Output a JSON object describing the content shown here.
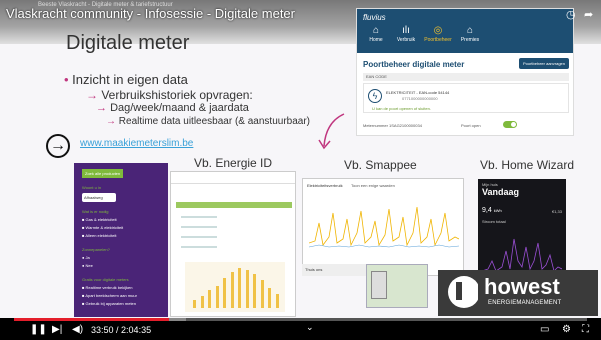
{
  "video": {
    "overlay_title": "Vlaskracht community - Infosessie - Digitale meter",
    "channel_subtitle": "Beeste Vlaskracht - Digitale meter & tariefstructuur"
  },
  "slide": {
    "title": "Digitale meter",
    "bullet_1": "Inzicht in eigen data",
    "bullet_2": "Verbruikshistoriek opvragen:",
    "bullet_3": "Dag/week/maand & jaardata",
    "bullet_4": "Realtime data uitleesbaar (& aanstuurbaar)",
    "link": "www.maakiemeterslim.be",
    "label_energie_id": "Vb. Energie ID",
    "label_smappee": "Vb. Smappee",
    "label_home_wizard": "Vb. Home Wizard"
  },
  "fluvius": {
    "logo": "fluvius",
    "tabs": [
      {
        "label": "Home",
        "icon": "home-icon"
      },
      {
        "label": "Verbruik",
        "icon": "chart-icon"
      },
      {
        "label": "Poortbeheer",
        "icon": "gateway-icon"
      },
      {
        "label": "Premies",
        "icon": "house-icon"
      }
    ],
    "active_tab": 2,
    "title": "Poortbeheer digitale meter",
    "button": "Poortbeheer aanvragen",
    "ean_header": "EAN CODE",
    "meter_type": "ELEKTRICITEIT - EAN-code 54144",
    "meter_id": "0771000000000000",
    "note": "U kan de poort openen of sluiten.",
    "meter_label": "Meternummer 1SAG2100000034",
    "poort_label": "Poort open",
    "accent": "#1d4e72"
  },
  "purple_panel": {
    "button": "Zoek alle producten",
    "heading_1": "Woont u in",
    "select": "Afhaalweg",
    "heading_2": "Wat is er nodig",
    "items_1": [
      "Gas & elektriciteit",
      "Warmte & elektriciteit",
      "Alleen elektriciteit"
    ],
    "heading_3": "Zonnepanelen?",
    "items_2": [
      "Ja",
      "Nee"
    ],
    "heading_4": "Gratis voor digitale meters",
    "items_3": [
      "Realtime verbruik bekijken",
      "Apart beeldscherm aan muur",
      "Gebruik bij apparaten meten"
    ]
  },
  "smappee": {
    "title": "Elektriciteitsverbruik",
    "sub": "Toon een enige waarden",
    "bottom_label": "Thuis ons"
  },
  "home_wizard": {
    "top": "Mijn huis",
    "title": "Vandaag",
    "value": "9,4",
    "unit": "kWh",
    "price": "Stroom totaal",
    "right": "€1,33"
  },
  "howest": {
    "name": "howest",
    "sub": "ENERGIEMANAGEMENT"
  },
  "player": {
    "current_time": "33:50",
    "separator": " / ",
    "duration": "2:04:35",
    "played_fraction": 0.27,
    "buffered_fraction": 0.3,
    "progress_color": "#e41e2b"
  }
}
